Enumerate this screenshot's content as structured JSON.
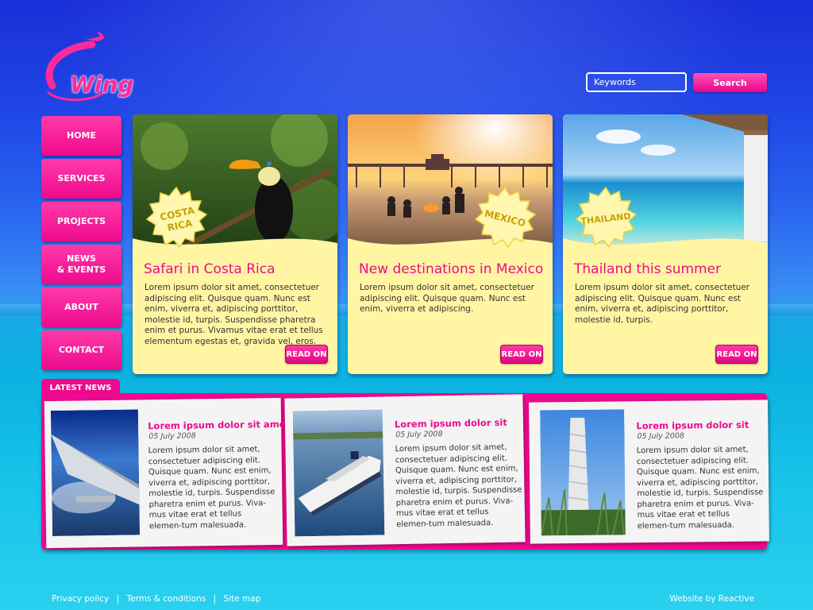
{
  "brand": {
    "logo_text": "Wing"
  },
  "search": {
    "placeholder": "Keywords",
    "button_label": "Search"
  },
  "nav": {
    "items": [
      {
        "label": "HOME"
      },
      {
        "label": "SERVICES"
      },
      {
        "label": "PROJECTS"
      },
      {
        "label": "NEWS\n& EVENTS"
      },
      {
        "label": "ABOUT"
      },
      {
        "label": "CONTACT"
      }
    ]
  },
  "features": [
    {
      "badge": "COSTA\nRICA",
      "title": "Safari in Costa Rica",
      "text": "Lorem ipsum dolor sit amet, consectetuer adipiscing elit. Quisque quam. Nunc est enim, viverra et, adipiscing porttitor, molestie id, turpis. Suspendisse pharetra enim et purus. Vivamus vitae erat et tellus elementum egestas et, gravida vel, eros.",
      "button": "READ ON"
    },
    {
      "badge": "MEXICO",
      "title": "New destinations in Mexico",
      "text": "Lorem ipsum dolor sit amet, consectetuer adipiscing elit. Quisque quam. Nunc est enim, viverra et adipiscing.",
      "button": "READ ON"
    },
    {
      "badge": "THAILAND",
      "title": "Thailand this summer",
      "text": "Lorem ipsum dolor sit amet, consectetuer adipiscing elit. Quisque quam. Nunc est enim, viverra et, adipiscing porttitor, molestie id, turpis.",
      "button": "READ ON"
    }
  ],
  "latest_news": {
    "tab_label": "LATEST NEWS",
    "items": [
      {
        "title": "Lorem ipsum dolor sit amet",
        "date": "05 July 2008",
        "text": "Lorem ipsum dolor sit amet, consectetuer adipiscing elit. Quisque quam. Nunc est enim, viverra et, adipiscing porttitor, molestie id, turpis. Suspendisse pharetra enim et purus. Viva-mus vitae erat et tellus elemen-tum malesuada."
      },
      {
        "title": "Lorem ipsum dolor sit",
        "date": "05 July 2008",
        "text": "Lorem ipsum dolor sit amet, consectetuer adipiscing elit. Quisque quam. Nunc est enim, viverra et, adipiscing porttitor, molestie id, turpis. Suspendisse pharetra enim et purus. Viva-mus vitae erat et tellus elemen-tum malesuada."
      },
      {
        "title": "Lorem ipsum dolor sit",
        "date": "05 July 2008",
        "text": "Lorem ipsum dolor sit amet, consectetuer adipiscing elit. Quisque quam. Nunc est enim, viverra et, adipiscing porttitor, molestie id, turpis. Suspendisse pharetra enim et purus. Viva-mus vitae erat et tellus elemen-tum malesuada."
      }
    ]
  },
  "footer": {
    "links": [
      "Privacy policy",
      "Terms & conditions",
      "Site map"
    ],
    "separator": "|",
    "credit": "Website by Reactive"
  },
  "colors": {
    "accent_pink": "#ee0a8e",
    "card_yellow": "#fff5a2",
    "sky_blue": "#1f46e6",
    "sea_cyan": "#19c4ea"
  }
}
